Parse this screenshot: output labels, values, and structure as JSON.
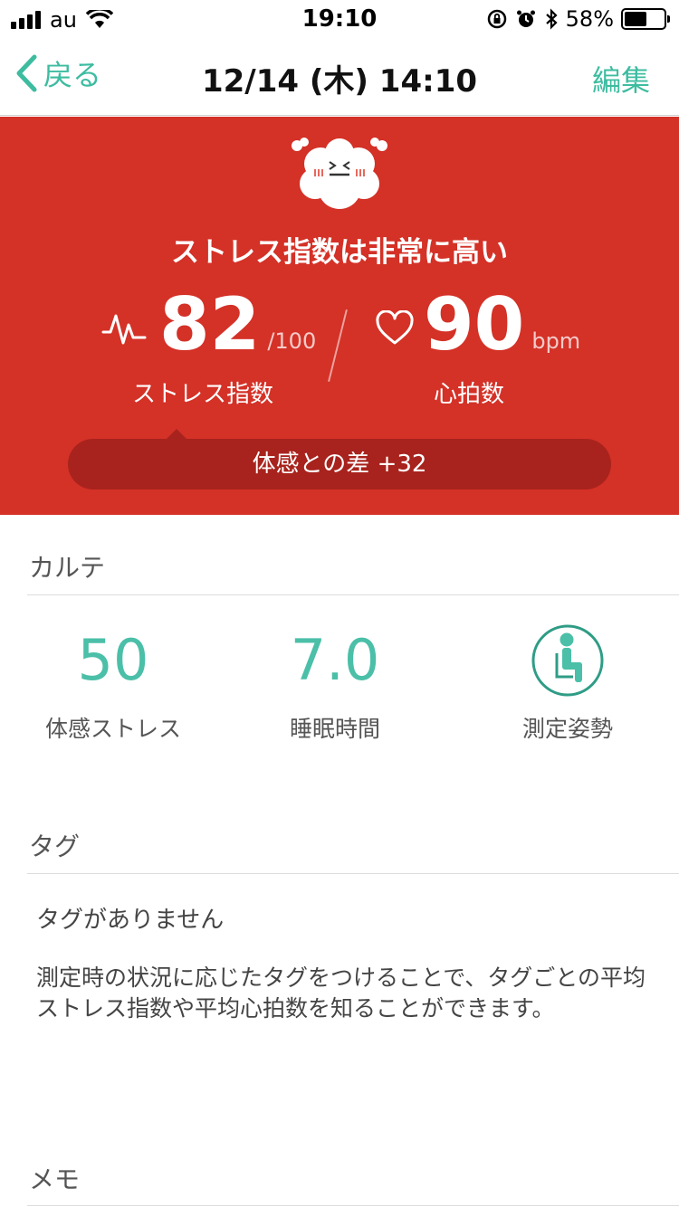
{
  "status_bar": {
    "carrier": "au",
    "time": "19:10",
    "battery_pct": "58%",
    "battery_level": 0.58
  },
  "nav": {
    "back_label": "戻る",
    "title": "12/14 (木)  14:10",
    "edit_label": "編集"
  },
  "hero": {
    "headline": "ストレス指数は非常に高い",
    "stress_value": "82",
    "stress_unit": "/100",
    "stress_label": "ストレス指数",
    "heart_value": "90",
    "heart_unit": "bpm",
    "heart_label": "心拍数",
    "diff_text": "体感との差 +32",
    "colors": {
      "background": "#d43127",
      "pill": "#a8231d"
    }
  },
  "karte": {
    "title": "カルテ",
    "items": [
      {
        "value": "50",
        "label": "体感ストレス"
      },
      {
        "value": "7.0",
        "label": "睡眠時間"
      },
      {
        "icon": "seated-person-icon",
        "label": "測定姿勢"
      }
    ],
    "accent": "#4bbfa8"
  },
  "tags": {
    "title": "タグ",
    "empty_text": "タグがありません",
    "description": "測定時の状況に応じたタグをつけることで、タグごとの平均ストレス指数や平均心拍数を知ることができます。"
  },
  "memo": {
    "title": "メモ"
  }
}
